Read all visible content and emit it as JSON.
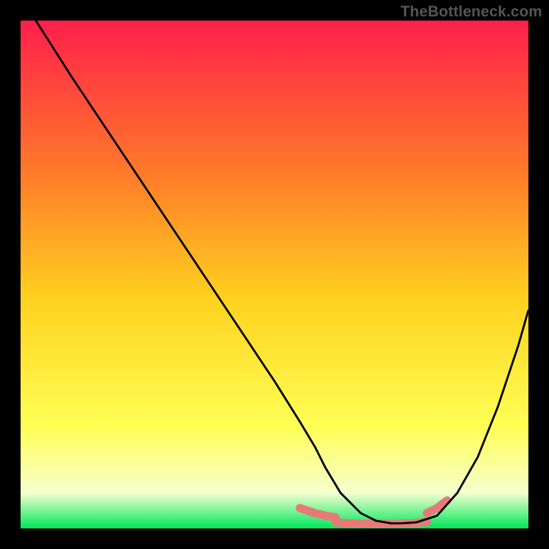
{
  "watermark": "TheBottleneck.com",
  "colors": {
    "gradient_top": "#ff1f4b",
    "gradient_mid_upper": "#ff7a2a",
    "gradient_mid": "#ffd21f",
    "gradient_lower": "#ffff55",
    "gradient_bottom_pale": "#f6ffcf",
    "gradient_bottom": "#00e85a",
    "curve": "#000000",
    "highlight": "#e77a77",
    "frame": "#000000"
  },
  "chart_data": {
    "type": "line",
    "title": "",
    "xlabel": "",
    "ylabel": "",
    "xlim": [
      0,
      100
    ],
    "ylim": [
      0,
      100
    ],
    "series": [
      {
        "name": "bottleneck-curve",
        "x": [
          3,
          10,
          20,
          30,
          40,
          50,
          55,
          58,
          60,
          63,
          67,
          70,
          73,
          75,
          78,
          82,
          86,
          90,
          94,
          98,
          100
        ],
        "y": [
          100,
          89,
          74,
          59,
          44,
          29,
          21,
          16,
          12,
          7,
          3,
          1.5,
          1,
          1,
          1.2,
          2.5,
          7,
          14,
          24,
          36,
          43
        ]
      }
    ],
    "highlight_segments": [
      {
        "x": [
          55,
          58,
          60,
          62
        ],
        "y": [
          4,
          3,
          2.5,
          2.2
        ]
      },
      {
        "x": [
          62,
          65,
          68,
          71,
          74,
          77,
          80
        ],
        "y": [
          1.2,
          1.0,
          0.9,
          0.9,
          0.9,
          1.0,
          1.3
        ]
      },
      {
        "x": [
          80,
          82,
          84
        ],
        "y": [
          3,
          4,
          5.5
        ]
      }
    ]
  }
}
